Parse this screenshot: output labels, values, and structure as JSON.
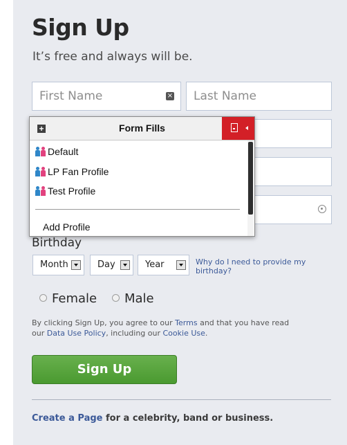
{
  "header": {
    "title": "Sign Up",
    "subtitle": "It’s free and always will be."
  },
  "fields": {
    "first_name_placeholder": "First Name",
    "last_name_placeholder": "Last Name"
  },
  "form_fills": {
    "title": "Form Fills",
    "profiles": [
      "Default",
      "LP Fan Profile",
      "Test Profile"
    ],
    "add_profile": "Add Profile",
    "icons": [
      "plus-icon",
      "lastpass-card-icon",
      "people-icon"
    ]
  },
  "birthday": {
    "label": "Birthday",
    "month": "Month",
    "day": "Day",
    "year": "Year",
    "why_link": "Why do I need to provide my birthday?"
  },
  "gender": {
    "female": "Female",
    "male": "Male"
  },
  "terms": {
    "prefix": "By clicking Sign Up, you agree to our ",
    "terms_link": "Terms",
    "middle": " and that you have read our ",
    "data_policy_link": "Data Use Policy",
    "middle2": ", including our ",
    "cookie_link": "Cookie Use",
    "suffix": "."
  },
  "signup_button": "Sign Up",
  "footer": {
    "create_page_link": "Create a Page",
    "rest": " for a celebrity, band or business."
  },
  "colors": {
    "panel_bg": "#e9ebf0",
    "link": "#3b5998",
    "signup_green": "#5aa53c",
    "lastpass_red": "#d32027"
  }
}
